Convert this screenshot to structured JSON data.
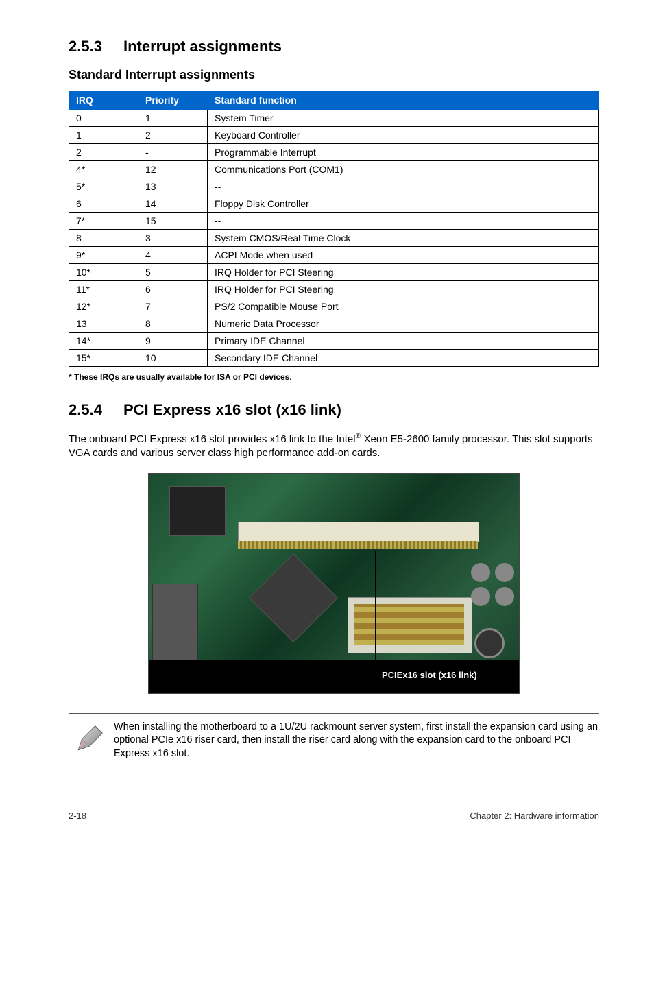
{
  "section1": {
    "number": "2.5.3",
    "title": "Interrupt assignments"
  },
  "subheading1": "Standard Interrupt assignments",
  "table": {
    "headers": [
      "IRQ",
      "Priority",
      "Standard function"
    ],
    "rows": [
      [
        "0",
        "1",
        "System Timer"
      ],
      [
        "1",
        "2",
        "Keyboard Controller"
      ],
      [
        "2",
        "-",
        "Programmable Interrupt"
      ],
      [
        "4*",
        "12",
        "Communications Port (COM1)"
      ],
      [
        "5*",
        "13",
        "--"
      ],
      [
        "6",
        "14",
        "Floppy Disk Controller"
      ],
      [
        "7*",
        "15",
        "--"
      ],
      [
        "8",
        "3",
        "System CMOS/Real Time Clock"
      ],
      [
        "9*",
        "4",
        "ACPI Mode when used"
      ],
      [
        "10*",
        "5",
        "IRQ Holder for PCI Steering"
      ],
      [
        "11*",
        "6",
        "IRQ Holder for PCI Steering"
      ],
      [
        "12*",
        "7",
        "PS/2 Compatible Mouse Port"
      ],
      [
        "13",
        "8",
        "Numeric Data Processor"
      ],
      [
        "14*",
        "9",
        "Primary IDE Channel"
      ],
      [
        "15*",
        "10",
        "Secondary IDE Channel"
      ]
    ]
  },
  "table_footnote": "* These IRQs are usually available for ISA or PCI devices.",
  "section2": {
    "number": "2.5.4",
    "title": "PCI Express x16 slot (x16 link)"
  },
  "body_pre": "The onboard PCI Express x16 slot provides x16 link to the Intel",
  "body_sup": "®",
  "body_post": " Xeon E5-2600 family processor. This slot supports VGA cards and various server class high performance add-on cards.",
  "photo_label": "PCIEx16 slot (x16 link)",
  "note": "When installing the motherboard to a 1U/2U rackmount server system, first install the expansion card using an optional PCIe x16 riser card, then install the riser card along with the expansion card to the onboard PCI Express x16 slot.",
  "footer": {
    "left": "2-18",
    "right": "Chapter 2: Hardware information"
  }
}
